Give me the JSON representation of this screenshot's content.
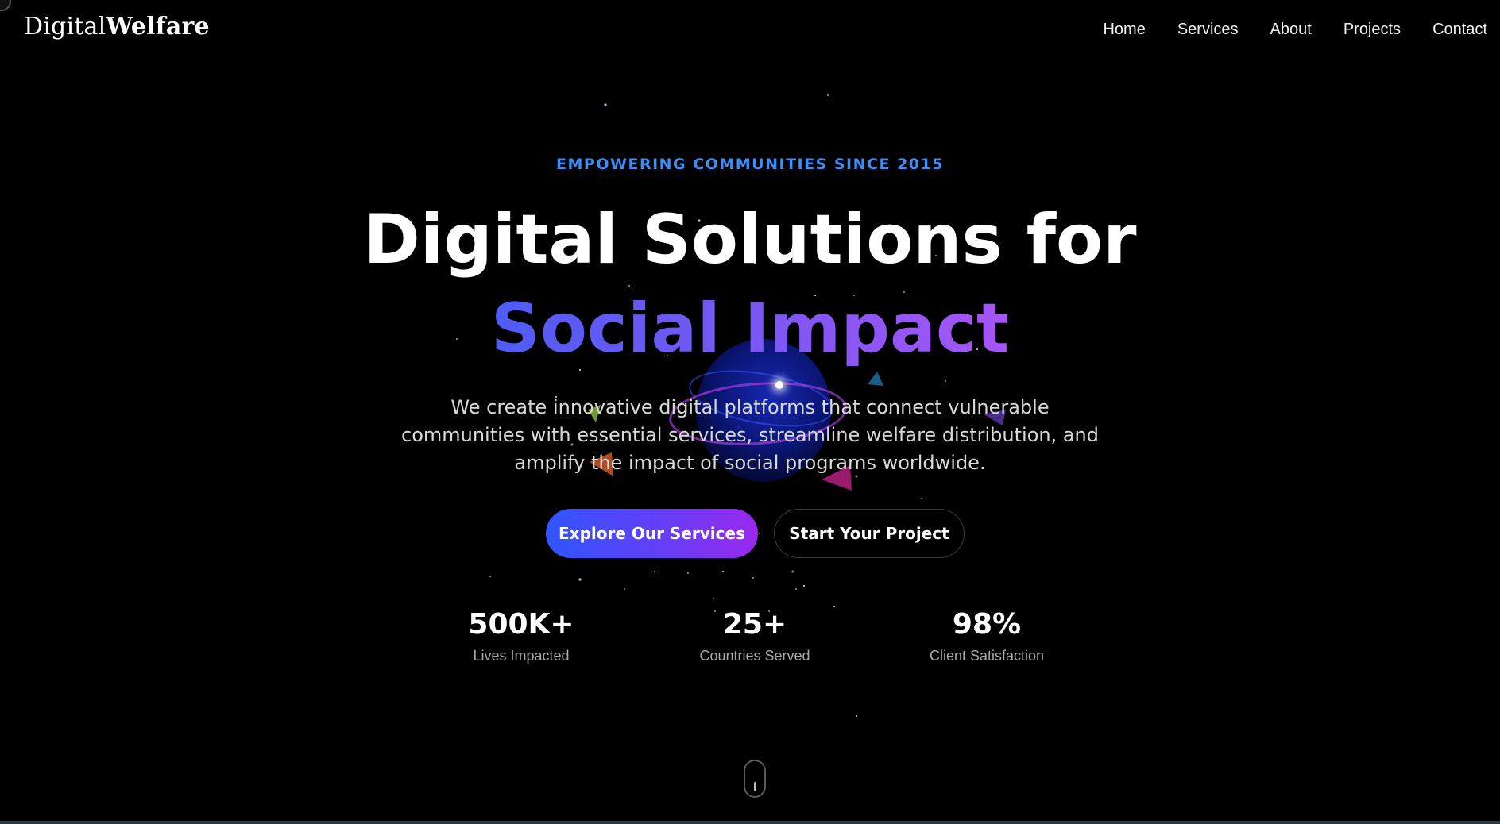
{
  "brand": {
    "name_light": "Digital",
    "name_bold": "Welfare"
  },
  "nav": {
    "items": [
      "Home",
      "Services",
      "About",
      "Projects",
      "Contact"
    ]
  },
  "hero": {
    "tagline": "EMPOWERING COMMUNITIES SINCE 2015",
    "title_line1": "Digital Solutions for",
    "title_line2": "Social Impact",
    "description": "We create innovative digital platforms that connect vulnerable communities with essential services, streamline welfare distribution, and amplify the impact of social programs worldwide.",
    "primary_button": "Explore Our Services",
    "secondary_button": "Start Your Project"
  },
  "stats": [
    {
      "value": "500K+",
      "label": "Lives Impacted"
    },
    {
      "value": "25+",
      "label": "Countries Served"
    },
    {
      "value": "98%",
      "label": "Client Satisfaction"
    }
  ],
  "colors": {
    "background": "#000000",
    "tagline": "#3f8ef5",
    "gradient_start": "#2f55ff",
    "gradient_end": "#9b28f0"
  }
}
